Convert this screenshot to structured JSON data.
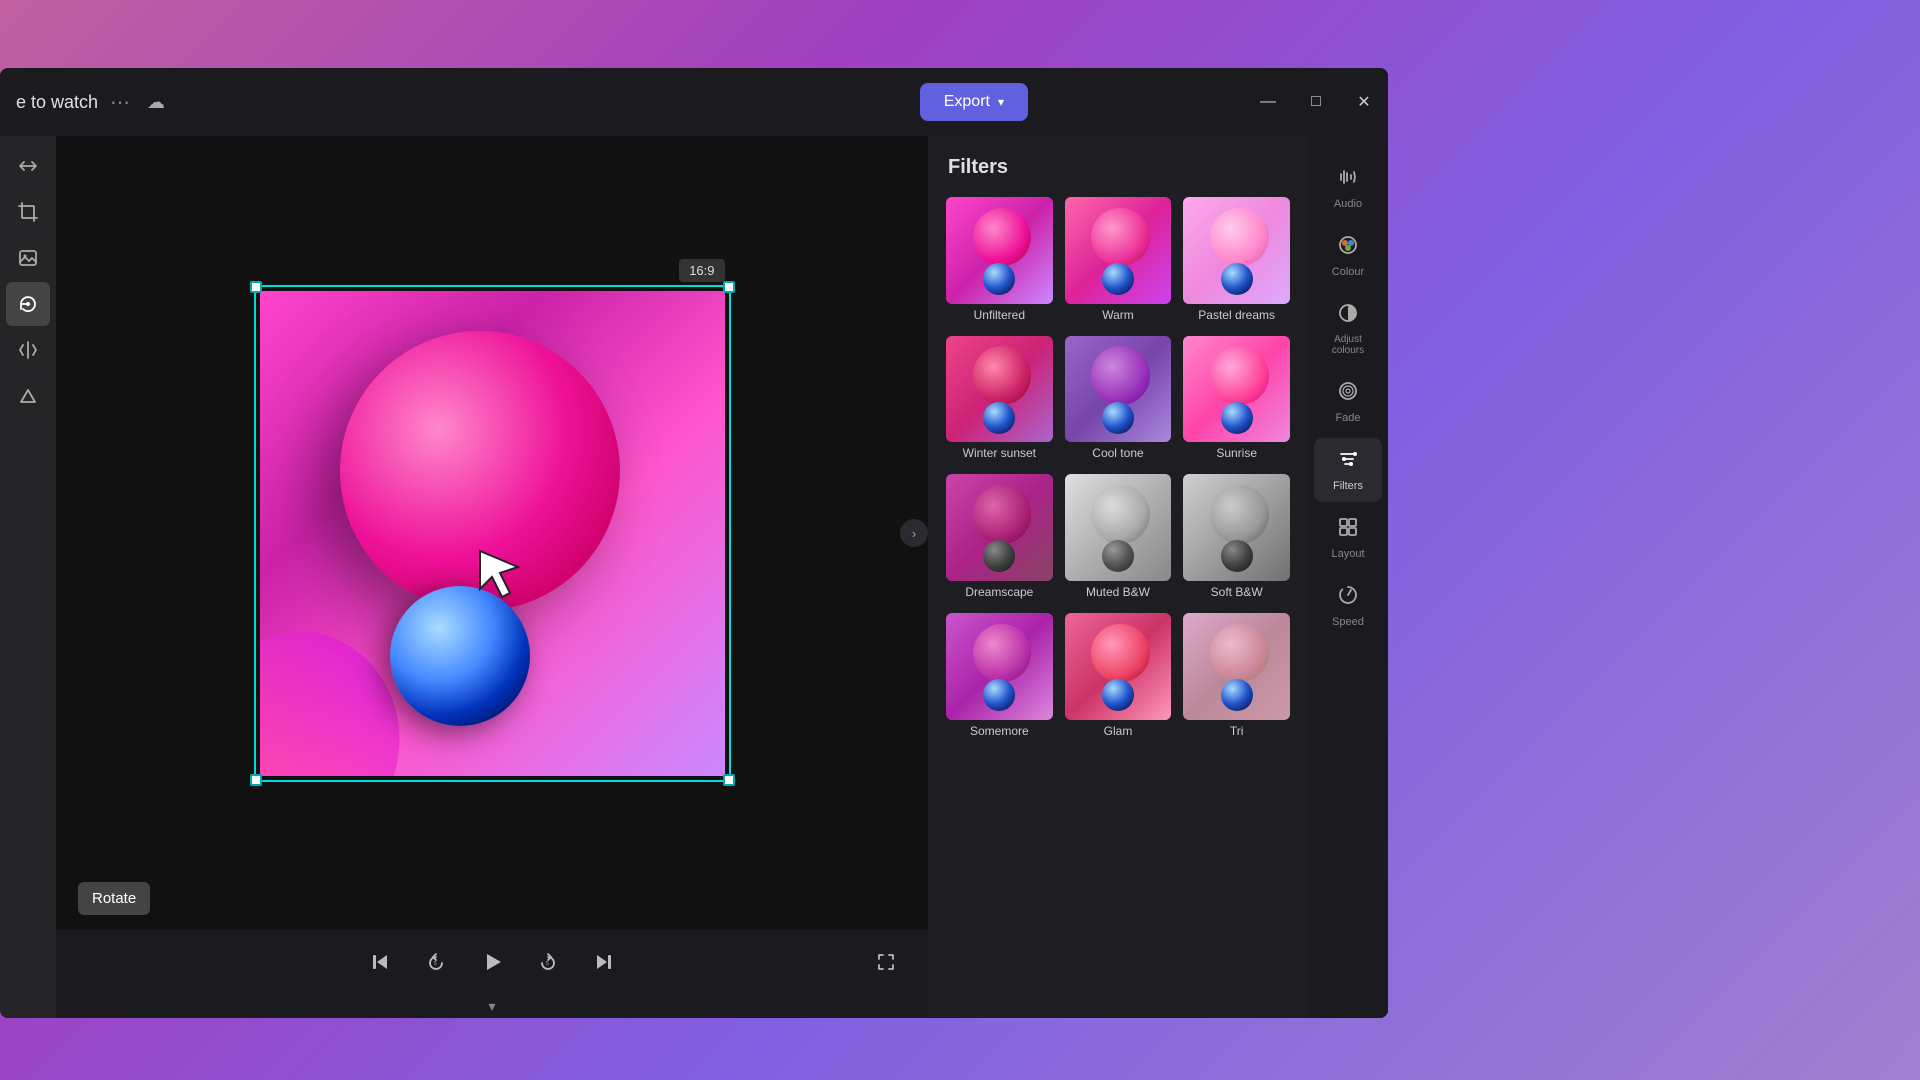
{
  "window": {
    "title": "e to watch",
    "controls": {
      "minimize": "—",
      "maximize": "□",
      "close": "✕"
    }
  },
  "titlebar": {
    "title": "e to watch",
    "export_label": "Export",
    "export_chevron": "▾"
  },
  "tools": [
    {
      "id": "flip",
      "icon": "⇔",
      "label": "Flip"
    },
    {
      "id": "crop",
      "icon": "⊡",
      "label": "Crop"
    },
    {
      "id": "image",
      "icon": "🖼",
      "label": "Image"
    },
    {
      "id": "rotate",
      "icon": "↻",
      "label": "Rotate"
    },
    {
      "id": "mirror",
      "icon": "△",
      "label": "Mirror"
    },
    {
      "id": "shape",
      "icon": "◁",
      "label": "Shape"
    }
  ],
  "rotate_label": "Rotate",
  "aspect_ratio": "16:9",
  "playback": {
    "skip_back": "⏮",
    "rewind": "↺",
    "play": "▶",
    "forward": "↻",
    "skip_forward": "⏭",
    "fullscreen": "⛶"
  },
  "filters": {
    "title": "Filters",
    "items": [
      {
        "id": "unfiltered",
        "name": "Unfiltered",
        "class": "ft-unfiltered"
      },
      {
        "id": "warm",
        "name": "Warm",
        "class": "ft-warm"
      },
      {
        "id": "pastel",
        "name": "Pastel dreams",
        "class": "ft-pastel"
      },
      {
        "id": "winter",
        "name": "Winter sunset",
        "class": "ft-winter"
      },
      {
        "id": "cool",
        "name": "Cool tone",
        "class": "ft-cool"
      },
      {
        "id": "sunrise",
        "name": "Sunrise",
        "class": "ft-sunrise"
      },
      {
        "id": "dreamscape",
        "name": "Dreamscape",
        "class": "ft-dreamscape"
      },
      {
        "id": "mutedbw",
        "name": "Muted B&W",
        "class": "ft-mutedbw"
      },
      {
        "id": "softbw",
        "name": "Soft B&W",
        "class": "ft-softbw"
      },
      {
        "id": "row4a",
        "name": "Somemore",
        "class": "ft-row4a"
      },
      {
        "id": "row4b",
        "name": "Glam",
        "class": "ft-row4b"
      },
      {
        "id": "row4c",
        "name": "Tri",
        "class": "ft-row4c"
      }
    ]
  },
  "right_sidebar": {
    "items": [
      {
        "id": "audio",
        "icon": "🔈",
        "label": "Audio"
      },
      {
        "id": "colour",
        "icon": "🎨",
        "label": "Colour"
      },
      {
        "id": "adjust",
        "icon": "◑",
        "label": "Adjust colours"
      },
      {
        "id": "fade",
        "icon": "◎",
        "label": "Fade"
      },
      {
        "id": "filters",
        "icon": "✦",
        "label": "Filters",
        "active": true
      },
      {
        "id": "layout",
        "icon": "⊞",
        "label": "Layout"
      },
      {
        "id": "speed",
        "icon": "⚡",
        "label": "Speed"
      }
    ]
  }
}
